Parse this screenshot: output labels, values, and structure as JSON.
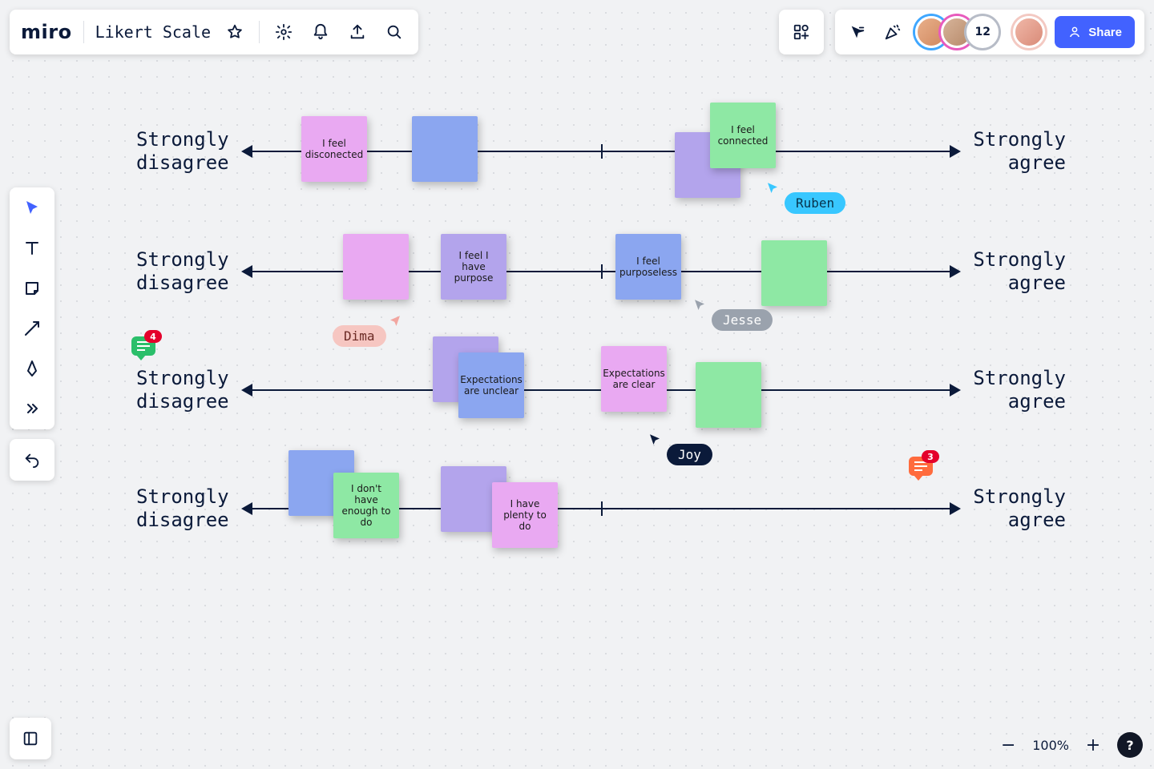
{
  "app": {
    "brand": "miro",
    "board_name": "Likert Scale"
  },
  "top_actions": {
    "share_label": "Share",
    "avatar_more_count": "12"
  },
  "zoom": {
    "level": "100%"
  },
  "labels": {
    "left": "Strongly\ndisagree",
    "right": "Strongly\nagree"
  },
  "notes": {
    "r1_pink": "I feel disconected",
    "r1_green": "I feel connected",
    "r2_violet": "I feel I have purpose",
    "r2_blue": "I feel purposeless",
    "r3_blue": "Expectations are unclear",
    "r3_pink": "Expectations are clear",
    "r4_green": "I don't have enough to do",
    "r4_pink": "I have plenty to do"
  },
  "cursors": {
    "ruben": "Ruben",
    "dima": "Dima",
    "jesse": "Jesse",
    "joy": "Joy"
  },
  "comments": {
    "left_count": "4",
    "right_count": "3"
  }
}
